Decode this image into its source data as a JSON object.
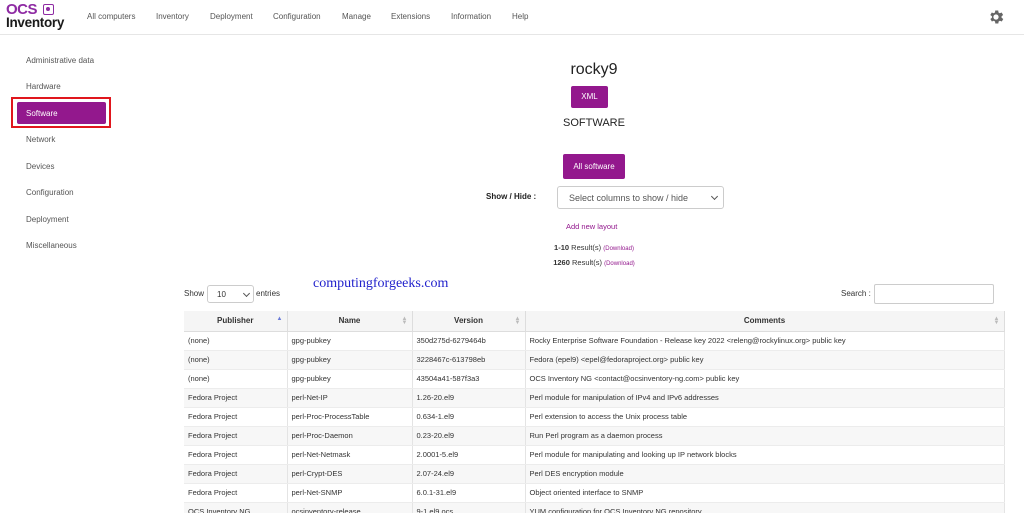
{
  "logo": {
    "top": "OCS",
    "bottom": "Inventory"
  },
  "nav": [
    "All computers",
    "Inventory",
    "Deployment",
    "Configuration",
    "Manage",
    "Extensions",
    "Information",
    "Help"
  ],
  "sidebar": [
    "Administrative data",
    "Hardware",
    "Software",
    "Network",
    "Devices",
    "Configuration",
    "Deployment",
    "Miscellaneous"
  ],
  "host": "rocky9",
  "xml_button": "XML",
  "section_title": "SOFTWARE",
  "all_software_button": "All software",
  "show_hide": {
    "label": "Show / Hide :",
    "placeholder": "Select columns to show / hide"
  },
  "add_layout": "Add new layout",
  "results": [
    {
      "range": "1-10",
      "label": "Result(s)",
      "link": "(Download)"
    },
    {
      "range": "1260",
      "label": "Result(s)",
      "link": "(Download)"
    }
  ],
  "watermark": "computingforgeeks.com",
  "entries": {
    "show": "Show",
    "value": "10",
    "suffix": "entries"
  },
  "search": {
    "label": "Search :"
  },
  "table": {
    "columns": [
      "Publisher",
      "Name",
      "Version",
      "Comments"
    ],
    "rows": [
      [
        "(none)",
        "gpg-pubkey",
        "350d275d-6279464b",
        "Rocky Enterprise Software Foundation - Release key 2022 <releng@rockylinux.org> public key"
      ],
      [
        "(none)",
        "gpg-pubkey",
        "3228467c-613798eb",
        "Fedora (epel9) <epel@fedoraproject.org> public key"
      ],
      [
        "(none)",
        "gpg-pubkey",
        "43504a41-587f3a3",
        "OCS Inventory NG <contact@ocsinventory-ng.com> public key"
      ],
      [
        "Fedora Project",
        "perl-Net-IP",
        "1.26-20.el9",
        "Perl module for manipulation of IPv4 and IPv6 addresses"
      ],
      [
        "Fedora Project",
        "perl-Proc-ProcessTable",
        "0.634-1.el9",
        "Perl extension to access the Unix process table"
      ],
      [
        "Fedora Project",
        "perl-Proc-Daemon",
        "0.23-20.el9",
        "Run Perl program as a daemon process"
      ],
      [
        "Fedora Project",
        "perl-Net-Netmask",
        "2.0001-5.el9",
        "Perl module for manipulating and looking up IP network blocks"
      ],
      [
        "Fedora Project",
        "perl-Crypt-DES",
        "2.07-24.el9",
        "Perl DES encryption module"
      ],
      [
        "Fedora Project",
        "perl-Net-SNMP",
        "6.0.1-31.el9",
        "Object oriented interface to SNMP"
      ],
      [
        "OCS Inventory NG",
        "ocsinventory-release",
        "9-1.el9.ocs",
        "YUM configuration for OCS Inventory NG repository"
      ]
    ]
  },
  "colors": {
    "accent": "#93188d",
    "highlight_border": "#e0161d",
    "watermark": "#2222cc"
  },
  "icons": {
    "settings": "gear-icon"
  }
}
